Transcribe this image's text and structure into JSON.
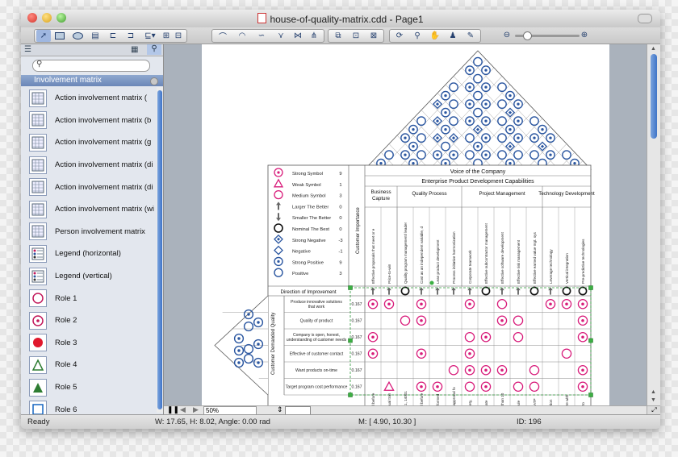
{
  "window": {
    "title": "house-of-quality-matrix.cdd - Page1"
  },
  "toolbar": {
    "icons": [
      "pointer-tool",
      "rectangle-tool",
      "ellipse-tool",
      "text-tool",
      "connector-1",
      "connector-2",
      "connector-3",
      "connector-4",
      "connector-5",
      "line-tool",
      "arc-tool",
      "bezier-tool",
      "polyline-tool",
      "smart-connector",
      "group-1",
      "group-2",
      "group-3",
      "rotate-tool",
      "zoom-tool",
      "hand-tool",
      "stamp-tool",
      "eyedropper-tool",
      "zoom-out",
      "zoom-slider",
      "zoom-in"
    ]
  },
  "sidebar": {
    "search_placeholder": "",
    "category": "Involvement matrix",
    "items": [
      {
        "label": "Action involvement matrix (",
        "icon": "matrix-icon"
      },
      {
        "label": "Action involvement matrix (b",
        "icon": "matrix-icon"
      },
      {
        "label": "Action involvement matrix (g",
        "icon": "matrix-icon"
      },
      {
        "label": "Action involvement matrix (di",
        "icon": "matrix-icon"
      },
      {
        "label": "Action involvement matrix (di",
        "icon": "matrix-icon"
      },
      {
        "label": "Action involvement matrix (wi",
        "icon": "matrix-icon"
      },
      {
        "label": "Person involvement matrix",
        "icon": "matrix-icon"
      },
      {
        "label": "Legend (horizontal)",
        "icon": "legend-icon"
      },
      {
        "label": "Legend (vertical)",
        "icon": "legend-icon"
      },
      {
        "label": "Role 1",
        "icon": "role-ring-icon"
      },
      {
        "label": "Role 2",
        "icon": "role-dot-ring-icon"
      },
      {
        "label": "Role 3",
        "icon": "role-filled-icon"
      },
      {
        "label": "Role 4",
        "icon": "role-triangle-icon"
      },
      {
        "label": "Role 5",
        "icon": "role-filled-triangle-icon"
      },
      {
        "label": "Role 6",
        "icon": "role-square-icon"
      }
    ]
  },
  "hbar": {
    "zoom": "50%"
  },
  "status": {
    "ready": "Ready",
    "dims": "W: 17.65,  H: 8.02,  Angle: 0.00 rad",
    "mouse": "M: [ 4.90, 10.30 ]",
    "id": "ID: 196"
  },
  "diagram": {
    "legend": [
      {
        "label": "Strong Symbol",
        "value": "9",
        "symbol": "dot-ring"
      },
      {
        "label": "Weak Symbol",
        "value": "1",
        "symbol": "triangle"
      },
      {
        "label": "Medium Symbol",
        "value": "3",
        "symbol": "ring"
      },
      {
        "label": "Larger The Better",
        "value": "0",
        "symbol": "arrow-up"
      },
      {
        "label": "Smaller The Better",
        "value": "0",
        "symbol": "arrow-down"
      },
      {
        "label": "Nominal The Best",
        "value": "0",
        "symbol": "black-ring"
      },
      {
        "label": "Strong Negative",
        "value": "-3",
        "symbol": "diamond-dot"
      },
      {
        "label": "Negative",
        "value": "-1",
        "symbol": "diamond"
      },
      {
        "label": "Strong Positive",
        "value": "9",
        "symbol": "blue-dot-ring"
      },
      {
        "label": "Positive",
        "value": "3",
        "symbol": "blue-ring"
      }
    ],
    "voice_of_company": "Voice of the Company",
    "capabilities": "Enterprise Product Development Capabilities",
    "groups": [
      "Business Capture",
      "Quality Process",
      "Project Management",
      "Technology Development"
    ],
    "customer_importance": "Customer Importance",
    "customer_quality": "Customer Demanded Quality",
    "direction_label": "Direction of Improvement",
    "columns": [
      "Effective proposals that meet or exceed custom needs",
      "Price-to-win",
      "Quality program management/ leadership",
      "Cost as an independent variable, design-to-cost",
      "Lean product development",
      "Process initiative harmonization",
      "Corporate teamwork",
      "Effective subcontractor management",
      "Effective software development",
      "Effective risk management",
      "Effective earned value mgt. sys",
      "Leverage technology",
      "Vertical integration",
      "Pre-predictive technologies"
    ],
    "rows": [
      {
        "label": "Produce innovative solutions that work",
        "weight": "0.167"
      },
      {
        "label": "Quality of product",
        "weight": "0.167"
      },
      {
        "label": "Company is open, honest, understanding of customer needs",
        "weight": "0.167"
      },
      {
        "label": "Effective of customer contact",
        "weight": "0.167"
      },
      {
        "label": "Want products on-time",
        "weight": "0.167"
      },
      {
        "label": "Target program cost performance",
        "weight": "0.167"
      }
    ],
    "bottom_cut_labels": [
      "l before",
      "ual tran",
      "1, 14001",
      "l before",
      "formed",
      "approval fo",
      "ety,",
      "ate",
      "than 10",
      "ule",
      "ATP",
      "tion",
      "te with",
      "to"
    ]
  }
}
